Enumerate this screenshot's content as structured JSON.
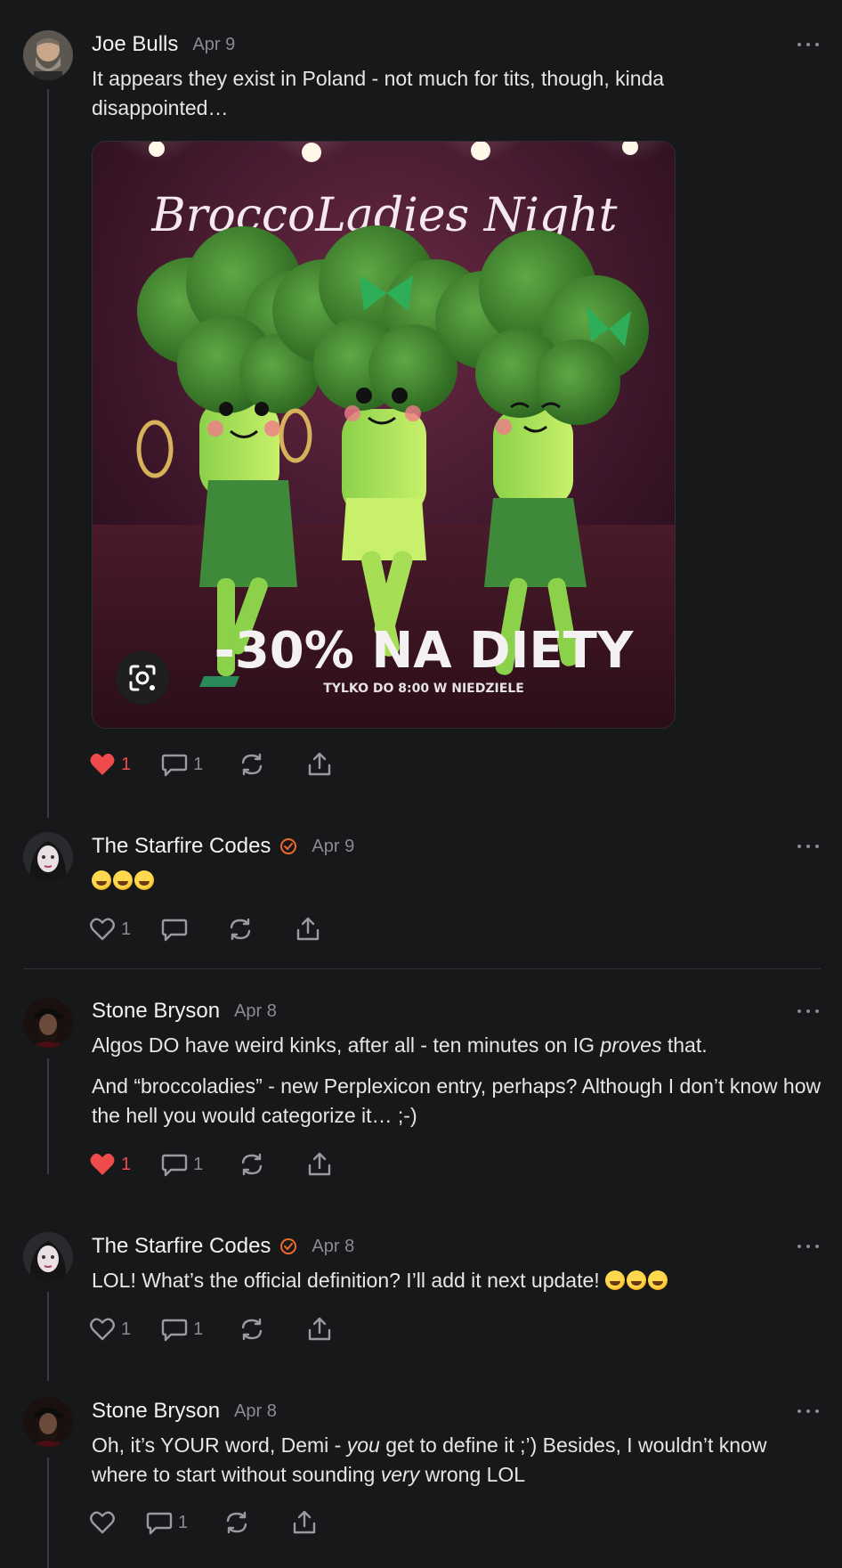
{
  "posts": [
    {
      "author": "Joe Bulls",
      "date": "Apr 9",
      "text": "It appears they exist in Poland - not much for tits, though, kinda disappointed…",
      "image": {
        "headline": "BroccoLadies Night",
        "promo": "-30% NA DIETY",
        "subline": "TYLKO DO 8:00 W NIEDZIELE"
      },
      "likes": "1",
      "comments": "1",
      "liked": true
    },
    {
      "author": "The Starfire Codes",
      "verified": true,
      "date": "Apr 9",
      "text": "🤣🤣🤣",
      "likes": "1",
      "comments": "",
      "liked": false
    },
    {
      "author": "Stone Bryson",
      "date": "Apr 8",
      "text_before": "Algos DO have weird kinks, after all - ten minutes on IG ",
      "text_em": "proves",
      "text_after": " that.",
      "text2": "And “broccoladies” - new Perplexicon entry, perhaps? Although I don’t know how the hell you would categorize it… ;-)",
      "likes": "1",
      "comments": "1",
      "liked": true
    },
    {
      "author": "The Starfire Codes",
      "verified": true,
      "date": "Apr 8",
      "text": "LOL! What’s the official definition? I’ll add it next update!",
      "likes": "1",
      "comments": "1",
      "liked": false
    },
    {
      "author": "Stone Bryson",
      "date": "Apr 8",
      "t1": "Oh, it’s YOUR word, Demi - ",
      "t1_em": "you",
      "t2": " get to define it ;’) Besides, I wouldn’t know where to start without sounding ",
      "t2_em": "very",
      "t3": " wrong LOL",
      "likes": "",
      "comments": "1",
      "liked": false
    }
  ],
  "colors": {
    "background": "#17181a",
    "liked": "#ef4b4b",
    "verified": "#f06a2a",
    "muted": "#8a8b8f"
  }
}
